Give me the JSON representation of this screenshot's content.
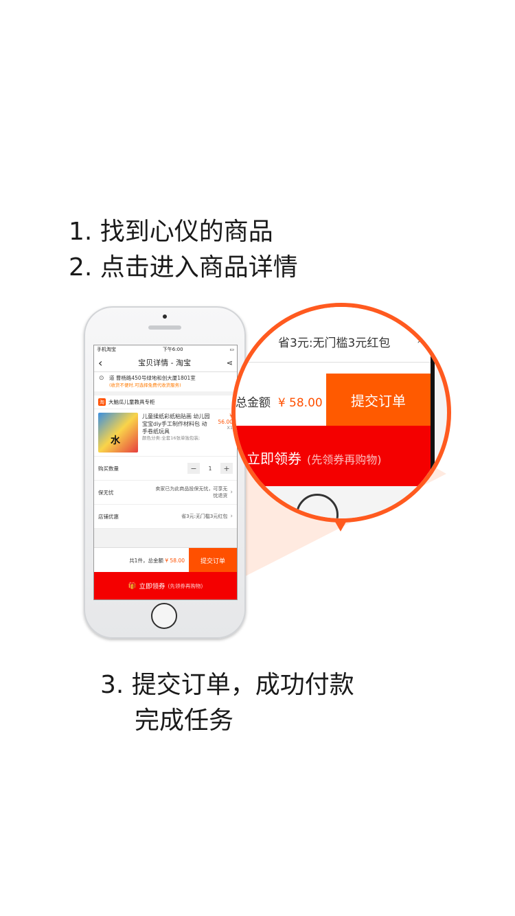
{
  "instructions": {
    "step1": "1. 找到心仪的商品",
    "step2": "2. 点击进入商品详情",
    "step3_line1": "3. 提交订单，成功付款",
    "step3_line2": "完成任务"
  },
  "phone": {
    "status": {
      "carrier": "手机淘宝",
      "time": "下午6:00"
    },
    "nav": {
      "back": "‹",
      "title": "宝贝详情 - 淘宝",
      "share": "share-icon"
    },
    "address": {
      "line1": "道 曹杨路450号绿地和创大厦1801室",
      "note": "(收货不便时,可选择免费代收货服务)"
    },
    "shop": {
      "logo": "淘",
      "name": "大脑瓜儿童教具专柜"
    },
    "product": {
      "title": "儿童揉纸彩纸粘贴画 幼儿园宝宝diy手工制作材料包 动手卷纸玩具",
      "spec": "颜色分类:全套16张单独包装;",
      "price": "¥ 56.00",
      "qty": "X1",
      "thumb_text": "水"
    },
    "rows": {
      "buy_qty_label": "购买数量",
      "minus": "−",
      "qty_value": "1",
      "plus": "+",
      "guarantee_label": "保无忧",
      "guarantee_text": "卖家已为此商品投保无忧，可享无忧退货",
      "shop_discount_label": "店铺优惠",
      "shop_discount_value": "省3元:无门槛3元红包"
    },
    "submit": {
      "total_prefix": "共1件，总金额",
      "total_value": "¥ 58.00",
      "button": "提交订单"
    },
    "coupon": {
      "button": "立即领券",
      "sub": "(先领券再购物)"
    }
  },
  "magnifier": {
    "discount": "省3元:无门槛3元红包",
    "total_label": "总金额",
    "total_value": "¥ 58.00",
    "submit": "提交订单",
    "coupon": "立即领券",
    "coupon_sub": "(先领券再购物)"
  },
  "colors": {
    "accent": "#ff5000",
    "coupon_red": "#f40000",
    "ring": "#ff5a1f"
  }
}
